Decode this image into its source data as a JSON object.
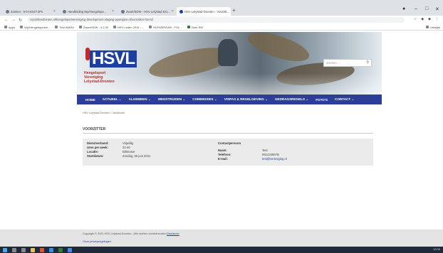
{
  "browser": {
    "tabs": [
      {
        "label": "Zoeken - 0-0-HOST-2Ps"
      },
      {
        "label": "Handleiding Wp/Hengelspo..."
      },
      {
        "label": "Zwart/SDW - HSV Lelystad Dro..."
      },
      {
        "label": "HSV Lelystad-Dronten - Voorzitt..."
      }
    ],
    "new_tab": "+",
    "window_controls": {
      "minimize": "–",
      "maximize": "□",
      "close": "✕"
    },
    "url": "voorzitterdronten.nl/hengelsportvereniging-development.staging.wpengine.nl/voorzitter-hsv-ld",
    "bookmarks": [
      {
        "label": "Apps"
      },
      {
        "label": "Wp/Hengelsportve..."
      },
      {
        "label": "Test WAOV"
      },
      {
        "label": "Zwart/SDW - 4.2.00"
      },
      {
        "label": "HSV Leden 2015 - ..."
      },
      {
        "label": "KLEWERGAN - FGL..."
      },
      {
        "label": "Zoek RM"
      }
    ],
    "bookmarks_right": "Leeslijst"
  },
  "site": {
    "logo_text": "HSVL",
    "logo_sub_1": "Hengelsport",
    "logo_sub_2": "Vereniging",
    "logo_sub_3": "Lelystad-Dronten",
    "search_placeholder": "Zoeken ...",
    "nav": [
      {
        "label": "HOME"
      },
      {
        "label": "ACTUEEL ⌄"
      },
      {
        "label": "ALGEMEEN ⌄"
      },
      {
        "label": "WEDSTRIJDEN ⌄"
      },
      {
        "label": "COMMISSIES ⌄"
      },
      {
        "label": "VISPAS & REGELGEVING ⌄"
      },
      {
        "label": "GEDRAGSREGELS ⌄"
      },
      {
        "label": "FOTO'S"
      },
      {
        "label": "CONTACT ⌄"
      }
    ],
    "breadcrumb": "HSV Lelystad-Dronten > Vacatures",
    "page_title": "VOORZITTER",
    "details": {
      "left": [
        {
          "label": "Dienstverband:",
          "value": "Vrijwillig"
        },
        {
          "label": "Uren per week:",
          "value": "32-40"
        },
        {
          "label": "Locatie:",
          "value": "Biltmoser"
        },
        {
          "label": "Startdatum:",
          "value": "Zondag, 06 juni 2021"
        }
      ],
      "contact_heading": "Contactpersoon",
      "right": [
        {
          "label": "Naam:",
          "value": "Test"
        },
        {
          "label": "Telefoon:",
          "value": "061234567B"
        },
        {
          "label": "E-mail:",
          "value": "test@vereniging.nl"
        }
      ]
    },
    "footer": {
      "copyright": "Copyright © 2021 HSV Lelystad-Dronten - Alle rechten voorbehouden",
      "disclaimer": "Disclaimer",
      "privacy": "Onze privacyregelingen"
    }
  },
  "taskbar": {
    "clock": "12:00"
  }
}
